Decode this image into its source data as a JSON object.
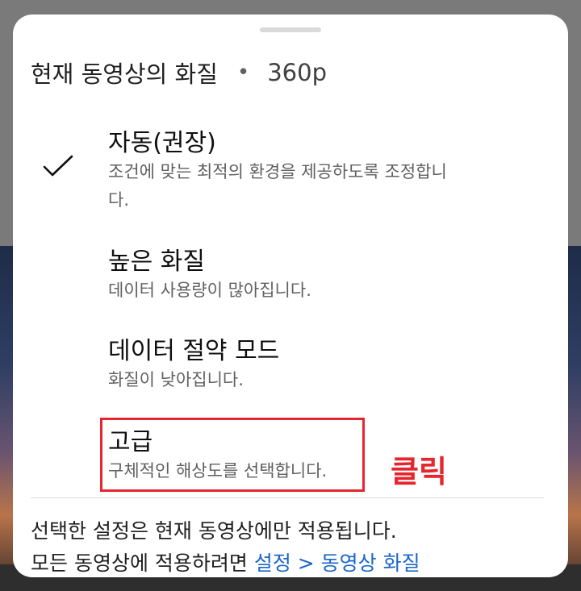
{
  "header": {
    "title": "현재 동영상의 화질",
    "separator": "•",
    "current_resolution": "360p"
  },
  "options": [
    {
      "title": "자동(권장)",
      "description": "조건에 맞는 최적의 환경을 제공하도록 조정합니다.",
      "selected": true
    },
    {
      "title": "높은 화질",
      "description": "데이터 사용량이 많아집니다.",
      "selected": false
    },
    {
      "title": "데이터 절약 모드",
      "description": "화질이 낮아집니다.",
      "selected": false
    },
    {
      "title": "고급",
      "description": "구체적인 해상도를 선택합니다.",
      "selected": false
    }
  ],
  "annotation": {
    "label": "클릭",
    "color": "#e6262e"
  },
  "footer": {
    "line1": "선택한 설정은 현재 동영상에만 적용됩니다.",
    "line2_prefix": "모든 동영상에 적용하려면 ",
    "link": "설정 > 동영상 화질"
  },
  "colors": {
    "link": "#1a66c9",
    "title_text": "#0f0f0f",
    "secondary_text": "#606060"
  },
  "icons": {
    "selected_indicator": "checkmark-icon",
    "sheet_handle": "drag-handle"
  }
}
